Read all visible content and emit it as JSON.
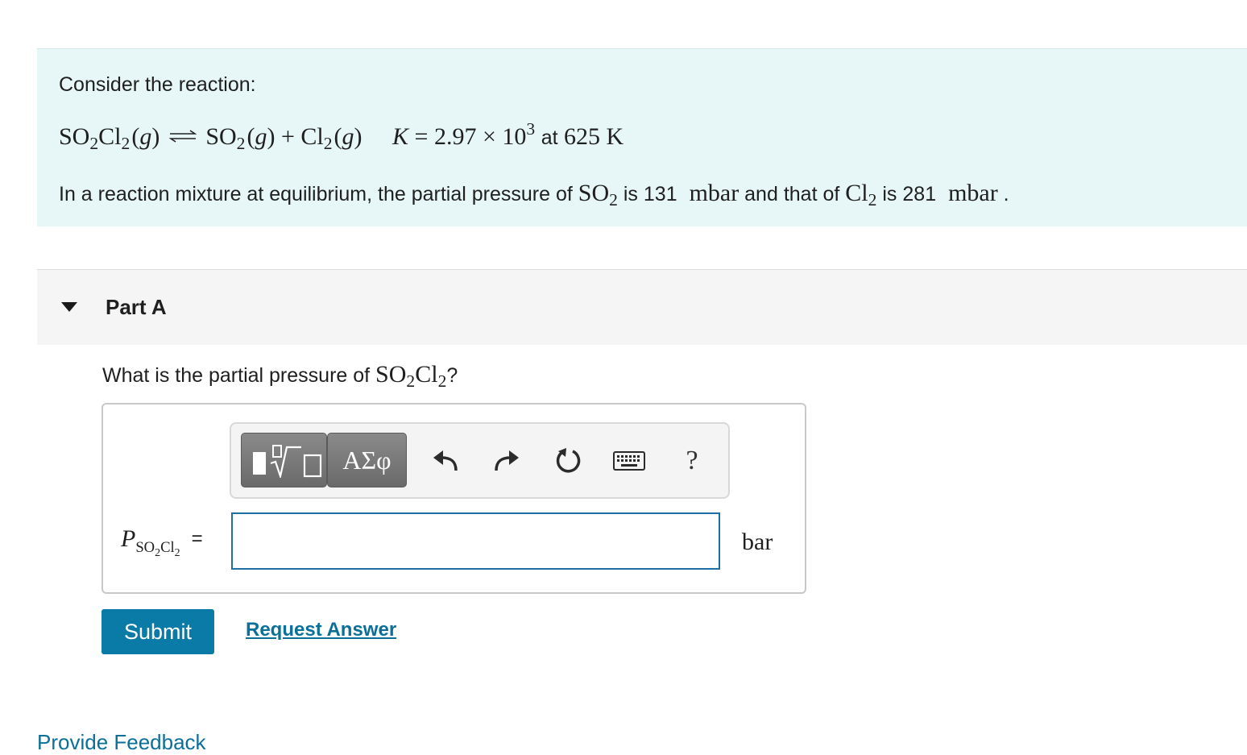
{
  "intro": {
    "lead": "Consider the reaction:",
    "equation": {
      "reactant": "SO2Cl2(g)",
      "products": "SO2(g) + Cl2(g)",
      "k_label": "K",
      "k_value": "2.97 × 10^3",
      "condition_text": "at",
      "temperature": "625 K"
    },
    "mixture": {
      "before_so2": "In a reaction mixture at equilibrium, the partial pressure of",
      "is_1": "is",
      "so2_value": "131",
      "unit_1": "mbar",
      "and_that": "and that of",
      "is_2": "is",
      "cl2_value": "281",
      "unit_2": "mbar",
      "period": "."
    }
  },
  "part": {
    "title": "Part A",
    "question_before": "What is the partial pressure of",
    "question_after": "?"
  },
  "toolbar": {
    "symbols_label": "ΑΣφ",
    "help_label": "?",
    "icons": [
      "templates-icon",
      "undo-icon",
      "redo-icon",
      "reset-icon",
      "keyboard-icon",
      "help-icon"
    ]
  },
  "answer": {
    "variable": "P",
    "subscript": "SO2Cl2",
    "equals": "=",
    "value": "",
    "placeholder": "",
    "unit": "bar"
  },
  "actions": {
    "submit_label": "Submit",
    "request_label": "Request Answer",
    "feedback_label": "Provide Feedback"
  },
  "colors": {
    "intro_bg": "#e7f6f6",
    "part_header_bg": "#f5f5f5",
    "primary": "#0a7aa6",
    "link": "#0a6f99",
    "input_border": "#1d6fa5"
  }
}
